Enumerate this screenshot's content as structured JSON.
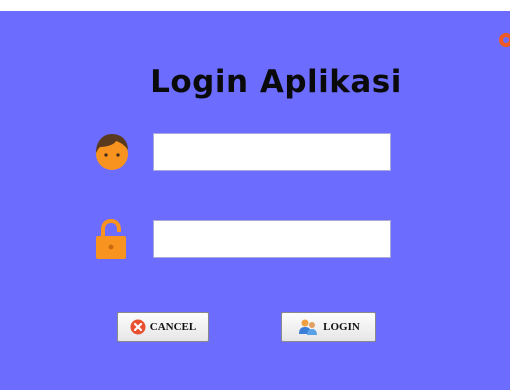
{
  "title": "Login Aplikasi",
  "username_field": {
    "value": "",
    "placeholder": ""
  },
  "password_field": {
    "value": "",
    "placeholder": ""
  },
  "buttons": {
    "cancel_label": "CANCEL",
    "login_label": "LOGIN"
  },
  "icons": {
    "close": "close-icon",
    "user": "user-icon",
    "lock": "lock-icon",
    "cancel": "cancel-icon",
    "login": "users-icon"
  },
  "colors": {
    "background": "#6c6cff",
    "title": "#0a0a0a",
    "accent": "#f5821f",
    "cancel_icon": "#e8502f"
  }
}
